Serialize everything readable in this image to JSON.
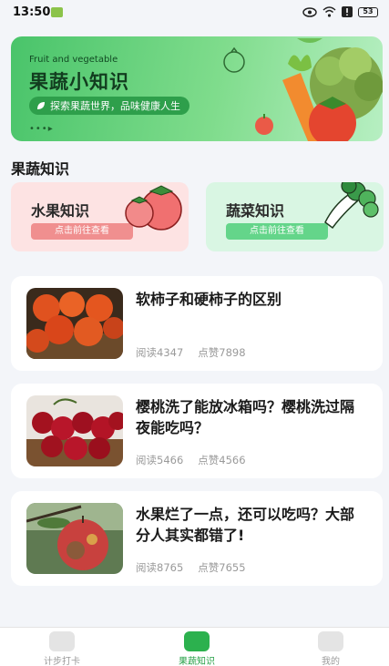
{
  "status_bar": {
    "time": "13:50",
    "battery": "53"
  },
  "banner": {
    "subtitle_en": "Fruit and vegetable",
    "title": "果蔬小知识",
    "tagline": "探索果蔬世界，品味健康人生",
    "dots": "•••▸"
  },
  "section": {
    "title": "果蔬知识"
  },
  "categories": [
    {
      "label": "水果知识",
      "button": "点击前往查看"
    },
    {
      "label": "蔬菜知识",
      "button": "点击前往查看"
    }
  ],
  "articles": [
    {
      "title": "软柿子和硬柿子的区别",
      "reads": "阅读4347",
      "likes": "点赞7898"
    },
    {
      "title": "樱桃洗了能放冰箱吗？樱桃洗过隔夜能吃吗？",
      "reads": "阅读5466",
      "likes": "点赞4566"
    },
    {
      "title": "水果烂了一点，还可以吃吗？大部分人其实都错了!",
      "reads": "阅读8765",
      "likes": "点赞7655"
    }
  ],
  "tabbar": {
    "items": [
      {
        "label": "计步打卡",
        "icon": "step-checkin-icon"
      },
      {
        "label": "果蔬知识",
        "icon": "fruit-knowledge-icon"
      },
      {
        "label": "我的",
        "icon": "profile-icon"
      }
    ],
    "active_index": 1
  },
  "colors": {
    "accent": "#25a046",
    "banner": "#49c46a",
    "fruit_card": "#fde3e3",
    "veg_card": "#d9f6e3"
  }
}
